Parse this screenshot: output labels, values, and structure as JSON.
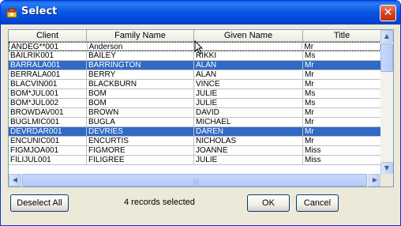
{
  "window": {
    "title": "Select",
    "close_label": "✕"
  },
  "grid": {
    "columns": [
      "Client",
      "Family Name",
      "Given Name",
      "Title"
    ],
    "rows": [
      {
        "client": "ANDEG**001",
        "family": "Anderson",
        "given": "",
        "title": "Mr",
        "selected": false,
        "focused": true
      },
      {
        "client": "BAILRIK001",
        "family": "BAILEY",
        "given": "RIKKI",
        "title": "Ms",
        "selected": false
      },
      {
        "client": "BARRALA001",
        "family": "BARRINGTON",
        "given": "ALAN",
        "title": "Mr",
        "selected": true
      },
      {
        "client": "BERRALA001",
        "family": "BERRY",
        "given": "ALAN",
        "title": "Mr",
        "selected": false
      },
      {
        "client": "BLACVIN001",
        "family": "BLACKBURN",
        "given": "VINCE",
        "title": "Mr",
        "selected": false
      },
      {
        "client": "BOM*JUL001",
        "family": "BOM",
        "given": "JULIE",
        "title": "Ms",
        "selected": false
      },
      {
        "client": "BOM*JUL002",
        "family": "BOM",
        "given": "JULIE",
        "title": "Ms",
        "selected": false
      },
      {
        "client": "BROWDAV001",
        "family": "BROWN",
        "given": "DAVID",
        "title": "Mr",
        "selected": false
      },
      {
        "client": "BUGLMIC001",
        "family": "BUGLA",
        "given": "MICHAEL",
        "title": "Mr",
        "selected": false
      },
      {
        "client": "DEVRDAR001",
        "family": "DEVRIES",
        "given": "DAREN",
        "title": "Mr",
        "selected": true
      },
      {
        "client": "ENCUNIC001",
        "family": "ENCURTIS",
        "given": "NICHOLAS",
        "title": "Mr",
        "selected": false
      },
      {
        "client": "FIGMJOA001",
        "family": "FIGMORE",
        "given": "JOANNE",
        "title": "Miss",
        "selected": false
      },
      {
        "client": "FILIJUL001",
        "family": "FILIGREE",
        "given": "JULIE",
        "title": "Miss",
        "selected": false
      }
    ]
  },
  "footer": {
    "deselect_label": "Deselect All",
    "status_text": "4 records selected",
    "ok_label": "OK",
    "cancel_label": "Cancel"
  },
  "colors": {
    "selection": "#316ac5",
    "titlebar": "#0a58e3"
  }
}
